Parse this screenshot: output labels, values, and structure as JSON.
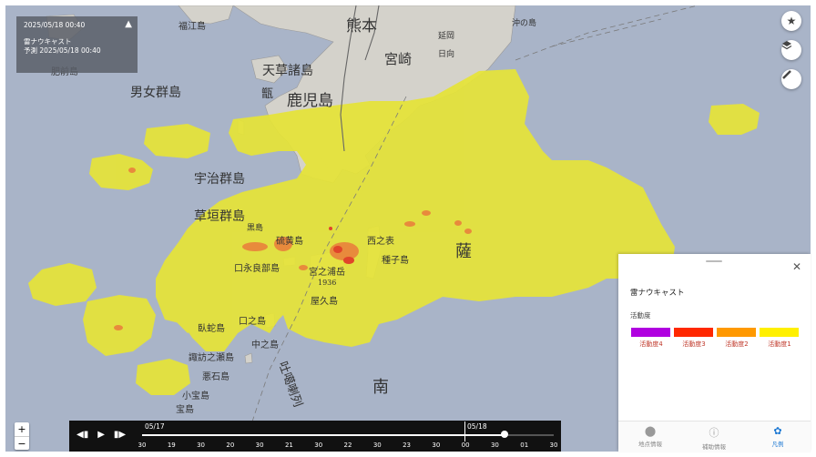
{
  "info_box": {
    "datetime": "2025/05/18 00:40",
    "title": "雷ナウキャスト",
    "forecast": "予測 2025/05/18 00:40"
  },
  "map_labels": {
    "kumamoto": "熊本",
    "miyazaki": "宮崎",
    "kagoshima": "鹿児島",
    "nobeoka": "延岡",
    "hyuga": "日向",
    "amakusa": "天草諸島",
    "koshiki": "甑",
    "danjo": "男女群島",
    "uji": "宇治群島",
    "kusagaki": "草垣群島",
    "tanegashima": "種子島",
    "nishinoomote": "西之表",
    "yakushima": "屋久島",
    "kuchinoerabu": "口永良部島",
    "iojima": "硫黄島",
    "kuroshima": "黒島",
    "nakanoshima": "中之島",
    "suwanose": "諏訪之瀬島",
    "akuseki": "悪石島",
    "kodakara": "小宝島",
    "takara": "宝島",
    "gajajima": "臥蛇島",
    "kuchinoshima": "口之島",
    "okinoshima": "沖の島",
    "miyanoura": "宮之浦岳",
    "miyanoura_elev": "1936",
    "tokara": "吐噶喇列",
    "minami": "南",
    "satsuma": "薩",
    "fukuejima": "福江島",
    "hizenshima": "肥前島"
  },
  "buttons": {
    "favorite_icon": "star-icon",
    "layers_icon": "layers-icon",
    "measure_icon": "ruler-icon",
    "zoom_in": "+",
    "zoom_out": "−"
  },
  "timebar": {
    "date1": "05/17",
    "date2": "05/18",
    "ticks": [
      "30",
      "19",
      "30",
      "20",
      "30",
      "21",
      "30",
      "22",
      "30",
      "23",
      "30",
      "00",
      "30",
      "01",
      "30"
    ],
    "progress": 0.88
  },
  "legend": {
    "title": "雷ナウキャスト",
    "subtitle": "活動度",
    "items": [
      {
        "label": "活動度4",
        "color": "#b000e0"
      },
      {
        "label": "活動度3",
        "color": "#ff2800"
      },
      {
        "label": "活動度2",
        "color": "#ff9900"
      },
      {
        "label": "活動度1",
        "color": "#fff000"
      }
    ]
  },
  "tabs": [
    {
      "label": "地点情報",
      "icon": "location-pin-icon"
    },
    {
      "label": "補助情報",
      "icon": "info-icon"
    },
    {
      "label": "凡例",
      "icon": "palette-icon"
    }
  ],
  "colors": {
    "sea": "#a9b4c8",
    "land": "#d5d3cc",
    "activity1": "#e6e437",
    "activity2": "#e88a3c",
    "activity3": "#e0452a"
  }
}
